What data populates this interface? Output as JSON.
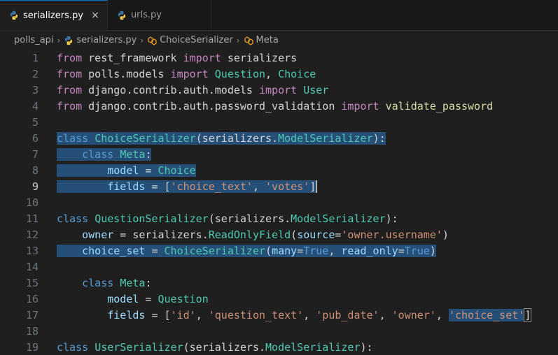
{
  "tabs": [
    {
      "label": "serializers.py",
      "active": true,
      "close": "×"
    },
    {
      "label": "urls.py",
      "active": false
    }
  ],
  "breadcrumb": {
    "folder": "polls_api",
    "file": "serializers.py",
    "class": "ChoiceSerializer",
    "inner": "Meta"
  },
  "lines": [
    {
      "n": "1",
      "tokens": [
        [
          "kw2",
          "from"
        ],
        [
          "plain",
          " rest_framework "
        ],
        [
          "kw2",
          "import"
        ],
        [
          "plain",
          " serializers"
        ]
      ]
    },
    {
      "n": "2",
      "tokens": [
        [
          "kw2",
          "from"
        ],
        [
          "plain",
          " polls.models "
        ],
        [
          "kw2",
          "import"
        ],
        [
          "plain",
          " "
        ],
        [
          "cls",
          "Question"
        ],
        [
          "plain",
          ", "
        ],
        [
          "cls",
          "Choice"
        ]
      ]
    },
    {
      "n": "3",
      "tokens": [
        [
          "kw2",
          "from"
        ],
        [
          "plain",
          " django.contrib.auth.models "
        ],
        [
          "kw2",
          "import"
        ],
        [
          "plain",
          " "
        ],
        [
          "cls",
          "User"
        ]
      ]
    },
    {
      "n": "4",
      "tokens": [
        [
          "kw2",
          "from"
        ],
        [
          "plain",
          " django.contrib.auth.password_validation "
        ],
        [
          "kw2",
          "import"
        ],
        [
          "plain",
          " "
        ],
        [
          "fn",
          "validate_password"
        ]
      ]
    },
    {
      "n": "5",
      "tokens": []
    },
    {
      "n": "6",
      "tokens": [
        [
          "kw",
          "class"
        ],
        [
          "plain",
          " "
        ],
        [
          "cls",
          "ChoiceSerializer"
        ],
        [
          "plain",
          "(serializers."
        ],
        [
          "cls",
          "ModelSerializer"
        ],
        [
          "plain",
          "):"
        ]
      ]
    },
    {
      "n": "7",
      "tokens": [
        [
          "plain",
          "    "
        ],
        [
          "kw",
          "class"
        ],
        [
          "plain",
          " "
        ],
        [
          "cls",
          "Meta"
        ],
        [
          "plain",
          ":"
        ]
      ]
    },
    {
      "n": "8",
      "tokens": [
        [
          "plain",
          "        "
        ],
        [
          "var",
          "model"
        ],
        [
          "op",
          " = "
        ],
        [
          "cls",
          "Choice"
        ]
      ]
    },
    {
      "n": "9",
      "tokens": [
        [
          "plain",
          "        "
        ],
        [
          "var",
          "fields"
        ],
        [
          "op",
          " = "
        ],
        [
          "plain",
          "["
        ],
        [
          "str",
          "'choice_text'"
        ],
        [
          "plain",
          ", "
        ],
        [
          "str",
          "'votes'"
        ],
        [
          "plain",
          "]"
        ]
      ]
    },
    {
      "n": "10",
      "tokens": []
    },
    {
      "n": "11",
      "tokens": [
        [
          "kw",
          "class"
        ],
        [
          "plain",
          " "
        ],
        [
          "cls",
          "QuestionSerializer"
        ],
        [
          "plain",
          "(serializers."
        ],
        [
          "cls",
          "ModelSerializer"
        ],
        [
          "plain",
          "):"
        ]
      ]
    },
    {
      "n": "12",
      "tokens": [
        [
          "plain",
          "    "
        ],
        [
          "var",
          "owner"
        ],
        [
          "op",
          " = "
        ],
        [
          "plain",
          "serializers."
        ],
        [
          "cls",
          "ReadOnlyField"
        ],
        [
          "plain",
          "("
        ],
        [
          "var",
          "source"
        ],
        [
          "op",
          "="
        ],
        [
          "str",
          "'owner.username'"
        ],
        [
          "plain",
          ")"
        ]
      ]
    },
    {
      "n": "13",
      "tokens": [
        [
          "plain",
          "    "
        ],
        [
          "var",
          "choice_set"
        ],
        [
          "op",
          " = "
        ],
        [
          "cls",
          "ChoiceSerializer"
        ],
        [
          "plain",
          "("
        ],
        [
          "var",
          "many"
        ],
        [
          "op",
          "="
        ],
        [
          "kw",
          "True"
        ],
        [
          "plain",
          ", "
        ],
        [
          "var",
          "read_only"
        ],
        [
          "op",
          "="
        ],
        [
          "kw",
          "True"
        ],
        [
          "plain",
          ")"
        ]
      ]
    },
    {
      "n": "14",
      "tokens": []
    },
    {
      "n": "15",
      "tokens": [
        [
          "plain",
          "    "
        ],
        [
          "kw",
          "class"
        ],
        [
          "plain",
          " "
        ],
        [
          "cls",
          "Meta"
        ],
        [
          "plain",
          ":"
        ]
      ]
    },
    {
      "n": "16",
      "tokens": [
        [
          "plain",
          "        "
        ],
        [
          "var",
          "model"
        ],
        [
          "op",
          " = "
        ],
        [
          "cls",
          "Question"
        ]
      ]
    },
    {
      "n": "17",
      "tokens": [
        [
          "plain",
          "        "
        ],
        [
          "var",
          "fields"
        ],
        [
          "op",
          " = "
        ],
        [
          "plain",
          "["
        ],
        [
          "str",
          "'id'"
        ],
        [
          "plain",
          ", "
        ],
        [
          "str",
          "'question_text'"
        ],
        [
          "plain",
          ", "
        ],
        [
          "str",
          "'pub_date'"
        ],
        [
          "plain",
          ", "
        ],
        [
          "str",
          "'owner'"
        ],
        [
          "plain",
          ", "
        ],
        [
          "str",
          "'choice_set'"
        ],
        [
          "plain",
          "]"
        ]
      ]
    },
    {
      "n": "18",
      "tokens": []
    },
    {
      "n": "19",
      "tokens": [
        [
          "kw",
          "class"
        ],
        [
          "plain",
          " "
        ],
        [
          "cls",
          "UserSerializer"
        ],
        [
          "plain",
          "(serializers."
        ],
        [
          "cls",
          "ModelSerializer"
        ],
        [
          "plain",
          "):"
        ]
      ]
    }
  ],
  "current_line": "9",
  "colors": {
    "selection": "#264f78",
    "accent": "#0078d4",
    "background": "#1f1f1f"
  },
  "icons": {
    "python": "python-file-icon",
    "symbol": "class-symbol-icon"
  }
}
